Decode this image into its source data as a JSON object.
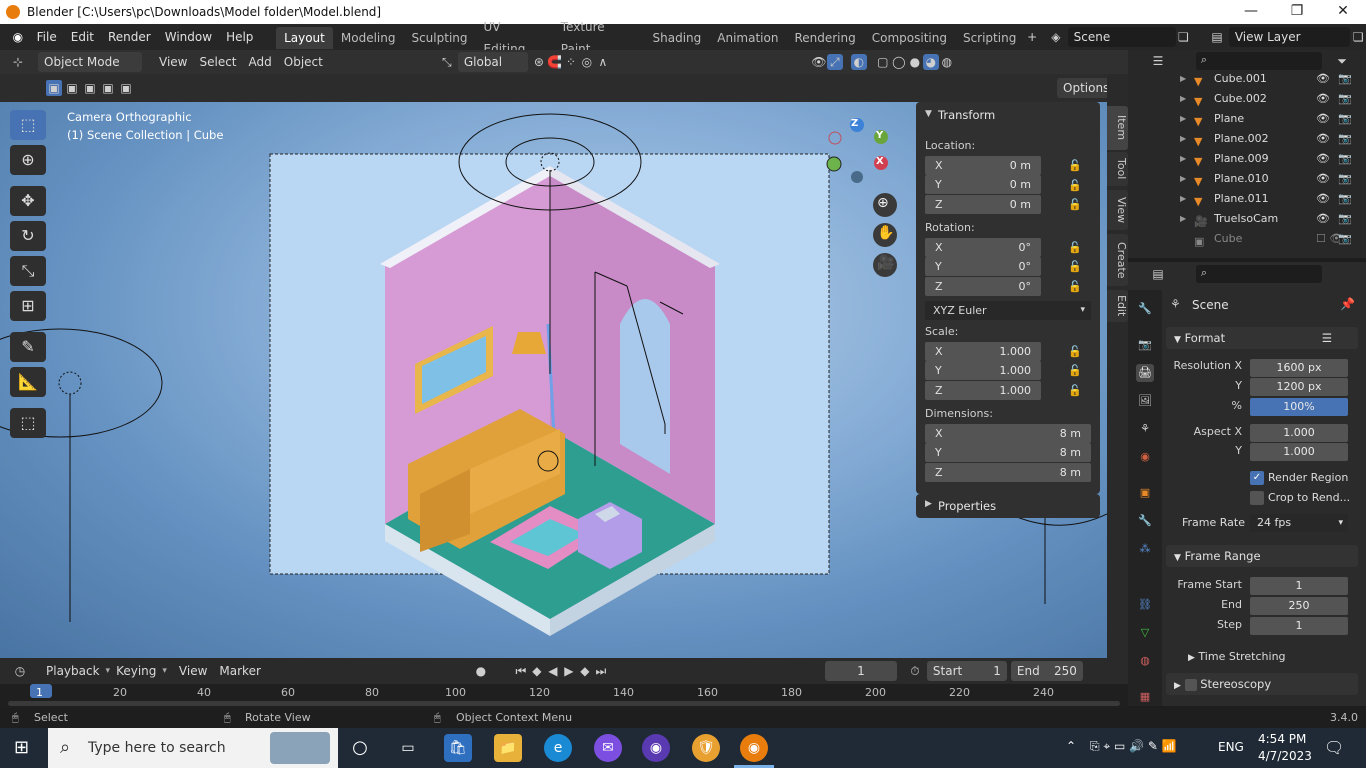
{
  "window": {
    "title": "Blender [C:\\Users\\pc\\Downloads\\Model folder\\Model.blend]",
    "minimize": "—",
    "maximize": "❐",
    "close": "✕"
  },
  "menu": [
    "File",
    "Edit",
    "Render",
    "Window",
    "Help"
  ],
  "workspaces": [
    "Layout",
    "Modeling",
    "Sculpting",
    "UV Editing",
    "Texture Paint",
    "Shading",
    "Animation",
    "Rendering",
    "Compositing",
    "Scripting"
  ],
  "active_workspace": "Layout",
  "scene": {
    "name": "Scene",
    "view_layer": "View Layer"
  },
  "viewport_header": {
    "mode": "Object Mode",
    "view": "View",
    "select": "Select",
    "add": "Add",
    "object": "Object",
    "orientation": "Global",
    "options": "Options"
  },
  "viewport": {
    "camera_label": "Camera Orthographic",
    "collection_label": "(1) Scene Collection | Cube"
  },
  "side_tabs": [
    "Item",
    "Tool",
    "View",
    "Create",
    "Edit"
  ],
  "transform": {
    "header": "Transform",
    "location_label": "Location:",
    "rotation_label": "Rotation:",
    "scale_label": "Scale:",
    "dimensions_label": "Dimensions:",
    "location": [
      {
        "axis": "X",
        "value": "0 m"
      },
      {
        "axis": "Y",
        "value": "0 m"
      },
      {
        "axis": "Z",
        "value": "0 m"
      }
    ],
    "rotation": [
      {
        "axis": "X",
        "value": "0°"
      },
      {
        "axis": "Y",
        "value": "0°"
      },
      {
        "axis": "Z",
        "value": "0°"
      }
    ],
    "rotation_mode": "XYZ Euler",
    "scale": [
      {
        "axis": "X",
        "value": "1.000"
      },
      {
        "axis": "Y",
        "value": "1.000"
      },
      {
        "axis": "Z",
        "value": "1.000"
      }
    ],
    "dimensions": [
      {
        "axis": "X",
        "value": "8 m"
      },
      {
        "axis": "Y",
        "value": "8 m"
      },
      {
        "axis": "Z",
        "value": "8 m"
      }
    ],
    "properties": "Properties"
  },
  "outliner": [
    {
      "name": "Cube.001"
    },
    {
      "name": "Cube.002"
    },
    {
      "name": "Plane"
    },
    {
      "name": "Plane.002"
    },
    {
      "name": "Plane.009"
    },
    {
      "name": "Plane.010"
    },
    {
      "name": "Plane.011"
    },
    {
      "name": "TrueIsoCam"
    },
    {
      "name": "Cube"
    }
  ],
  "properties": {
    "context": "Scene",
    "format_header": "Format",
    "resolution_x_label": "Resolution X",
    "resolution_x": "1600 px",
    "resolution_y_label": "Y",
    "resolution_y": "1200 px",
    "percent_label": "%",
    "percent": "100%",
    "aspect_x_label": "Aspect X",
    "aspect_x": "1.000",
    "aspect_y_label": "Y",
    "aspect_y": "1.000",
    "render_region": "Render Region",
    "crop": "Crop to Rend...",
    "frame_rate_label": "Frame Rate",
    "frame_rate": "24 fps",
    "frame_range_header": "Frame Range",
    "frame_start_label": "Frame Start",
    "frame_start": "1",
    "end_label": "End",
    "end": "250",
    "step_label": "Step",
    "step": "1",
    "time_stretching": "Time Stretching",
    "stereoscopy": "Stereoscopy"
  },
  "timeline": {
    "playback": "Playback",
    "keying": "Keying",
    "view": "View",
    "marker": "Marker",
    "current_frame": "1",
    "start_label": "Start",
    "start": "1",
    "end_label": "End",
    "end": "250",
    "ticks": [
      "1",
      "20",
      "40",
      "60",
      "80",
      "100",
      "120",
      "140",
      "160",
      "180",
      "200",
      "220",
      "240"
    ]
  },
  "status": {
    "select": "Select",
    "rotate": "Rotate View",
    "context_menu": "Object Context Menu",
    "version": "3.4.0"
  },
  "taskbar": {
    "search_placeholder": "Type here to search",
    "time": "4:54 PM",
    "date": "4/7/2023",
    "lang": "ENG"
  }
}
